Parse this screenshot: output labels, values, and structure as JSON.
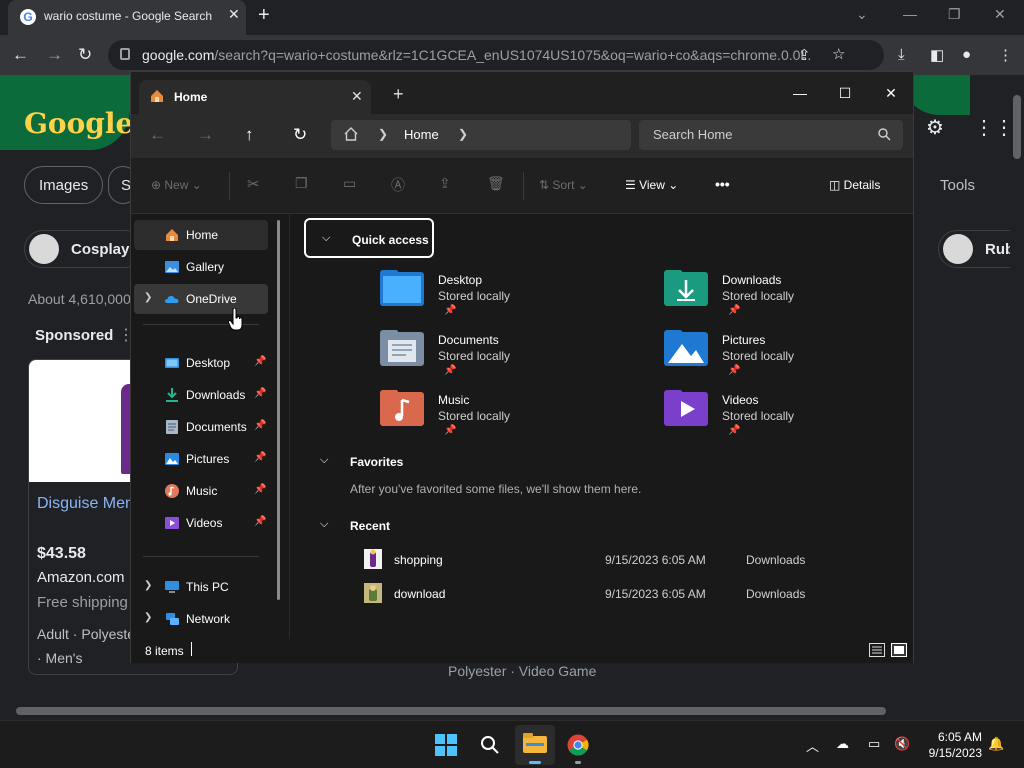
{
  "chrome": {
    "tab_title": "wario costume - Google Search",
    "tab_favicon": "G",
    "url_domain": "google.com",
    "url_rest": "/search?q=wario+costume&rlz=1C1GCEA_enUS1074US1075&oq=wario+co&aqs=chrome.0.0i...",
    "accent": "#35363a"
  },
  "google": {
    "logo": "Google",
    "chips": [
      "Images",
      "Sh"
    ],
    "chip_cosplay": "Cosplay",
    "chip_rub": "Rub",
    "about": "About 4,610,000",
    "sponsored": "Sponsored",
    "card_title": "Disguise Men Mario Wario I",
    "card_price": "$43.58",
    "card_store": "Amazon.com",
    "card_shipping": "Free shipping",
    "card_meta1": "Adult · Polyeste",
    "card_meta2": "· Men's",
    "footer_text": "Polyester · Video Game",
    "tools": "Tools"
  },
  "explorer": {
    "tab_label": "Home",
    "address_crumb": "Home",
    "search_placeholder": "Search Home",
    "commands": {
      "new": "New",
      "sort": "Sort",
      "view": "View",
      "more": "•••",
      "details": "Details"
    },
    "nav": {
      "home": "Home",
      "gallery": "Gallery",
      "onedrive": "OneDrive",
      "desktop": "Desktop",
      "downloads": "Downloads",
      "documents": "Documents",
      "pictures": "Pictures",
      "music": "Music",
      "videos": "Videos",
      "this_pc": "This PC",
      "network": "Network"
    },
    "quick_access_title": "Quick access",
    "quick_access": [
      {
        "name": "Desktop",
        "status": "Stored locally",
        "color": "#2f8fe0"
      },
      {
        "name": "Downloads",
        "status": "Stored locally",
        "color": "#1fae8f"
      },
      {
        "name": "Documents",
        "status": "Stored locally",
        "color": "#8aa3bd"
      },
      {
        "name": "Pictures",
        "status": "Stored locally",
        "color": "#2a8ae0"
      },
      {
        "name": "Music",
        "status": "Stored locally",
        "color": "#e0785a"
      },
      {
        "name": "Videos",
        "status": "Stored locally",
        "color": "#8a4fd6"
      }
    ],
    "favorites_title": "Favorites",
    "favorites_empty": "After you've favorited some files, we'll show them here.",
    "recent_title": "Recent",
    "recent": [
      {
        "name": "shopping",
        "date": "9/15/2023 6:05 AM",
        "location": "Downloads"
      },
      {
        "name": "download",
        "date": "9/15/2023 6:05 AM",
        "location": "Downloads"
      }
    ],
    "status_count": "8 items"
  },
  "taskbar": {
    "time": "6:05 AM",
    "date": "9/15/2023",
    "accent": "#5cb8ff"
  }
}
